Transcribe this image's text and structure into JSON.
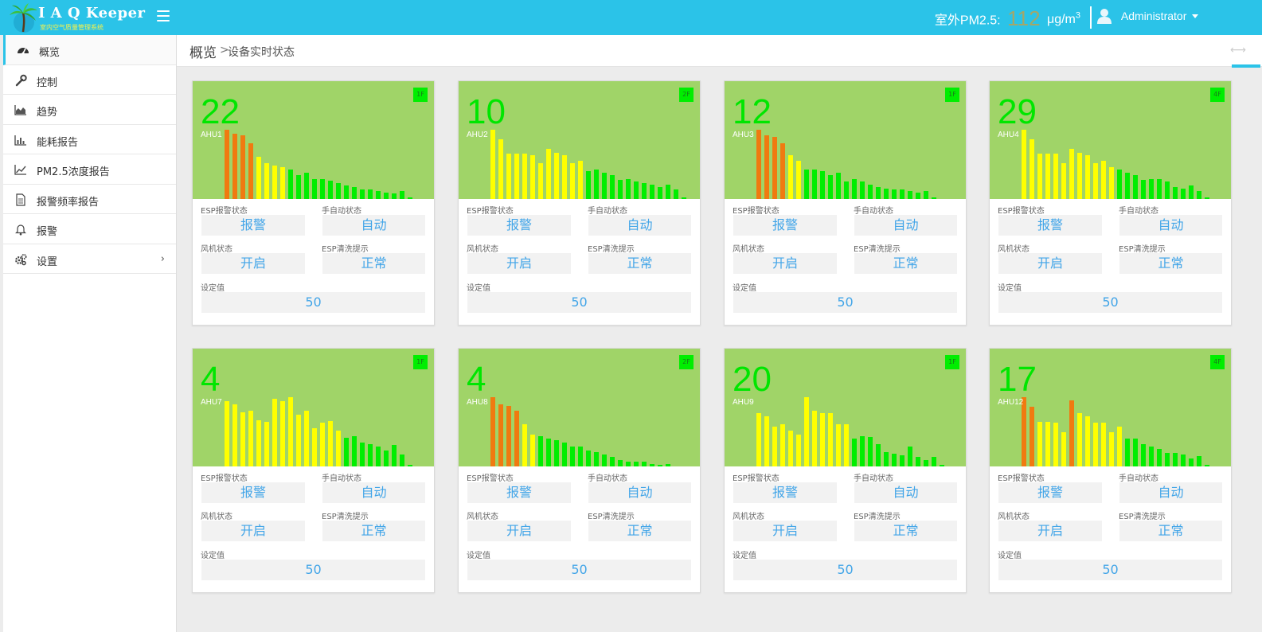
{
  "app": {
    "title": "I A Q Keeper",
    "subtitle": "室内空气质量管理系统"
  },
  "topbar": {
    "pm_label": "室外PM2.5:",
    "pm_value": "112",
    "pm_unit": "μg/m",
    "pm_unit_sup": "3",
    "user": "Administrator"
  },
  "sidebar": {
    "items": [
      {
        "label": "概览",
        "icon": "dashboard-icon",
        "active": true
      },
      {
        "label": "控制",
        "icon": "wrench-icon"
      },
      {
        "label": "趋势",
        "icon": "area-chart-icon"
      },
      {
        "label": "能耗报告",
        "icon": "bar-chart-icon"
      },
      {
        "label": "PM2.5浓度报告",
        "icon": "line-chart-icon"
      },
      {
        "label": "报警频率报告",
        "icon": "document-icon"
      },
      {
        "label": "报警",
        "icon": "bell-icon"
      },
      {
        "label": "设置",
        "icon": "gears-icon",
        "chevron": "›"
      }
    ]
  },
  "breadcrumb": {
    "root": "概览",
    "sep": ">",
    "current": "设备实时状态",
    "collapse_icon": "⟷"
  },
  "labels": {
    "esp_alarm": "ESP报警状态",
    "manual_auto": "手自动状态",
    "fan": "风机状态",
    "esp_clean": "ESP清洗提示",
    "setpoint": "设定值"
  },
  "colors": {
    "topbar": "#2bc3e8",
    "chart_bg": "#a0d468",
    "bar_orange": "#f07a10",
    "bar_yellow": "#ffff00",
    "bar_green": "#00ee00",
    "value_blue": "#42a5e8",
    "big_number": "#00e600"
  },
  "devices": [
    {
      "name": "AHU1",
      "value": "22",
      "badge": "1F",
      "esp_alarm": "报警",
      "mode": "自动",
      "fan": "开启",
      "esp_clean": "正常",
      "setpoint": "50",
      "bars": [
        87,
        82,
        80,
        70,
        53,
        45,
        42,
        40,
        37,
        30,
        33,
        25,
        25,
        23,
        20,
        17,
        15,
        12,
        12,
        10,
        8,
        7,
        10,
        2
      ]
    },
    {
      "name": "AHU2",
      "value": "10",
      "badge": "2F",
      "esp_alarm": "报警",
      "mode": "自动",
      "fan": "开启",
      "esp_clean": "正常",
      "setpoint": "50",
      "bars": [
        87,
        75,
        57,
        57,
        57,
        55,
        45,
        63,
        58,
        55,
        45,
        48,
        35,
        37,
        33,
        30,
        24,
        25,
        22,
        20,
        18,
        15,
        18,
        12,
        2
      ]
    },
    {
      "name": "AHU3",
      "value": "12",
      "badge": "1F",
      "esp_alarm": "报警",
      "mode": "自动",
      "fan": "开启",
      "esp_clean": "正常",
      "setpoint": "50",
      "bars": [
        87,
        80,
        78,
        70,
        55,
        48,
        37,
        37,
        35,
        30,
        33,
        22,
        25,
        22,
        18,
        15,
        13,
        12,
        12,
        10,
        8,
        10,
        2
      ]
    },
    {
      "name": "AHU4",
      "value": "29",
      "badge": "4F",
      "esp_alarm": "报警",
      "mode": "自动",
      "fan": "开启",
      "esp_clean": "正常",
      "setpoint": "50",
      "bars": [
        87,
        75,
        57,
        57,
        57,
        45,
        63,
        58,
        55,
        45,
        48,
        40,
        37,
        33,
        30,
        24,
        25,
        25,
        22,
        15,
        13,
        17,
        10,
        2
      ]
    },
    {
      "name": "AHU7",
      "value": "4",
      "badge": "1F",
      "esp_alarm": "报警",
      "mode": "自动",
      "fan": "开启",
      "esp_clean": "正常",
      "setpoint": "50",
      "bars": [
        82,
        78,
        68,
        70,
        58,
        56,
        85,
        82,
        87,
        65,
        70,
        48,
        55,
        57,
        45,
        36,
        38,
        30,
        28,
        25,
        20,
        27,
        15,
        2
      ]
    },
    {
      "name": "AHU8",
      "value": "4",
      "badge": "2F",
      "esp_alarm": "报警",
      "mode": "自动",
      "fan": "开启",
      "esp_clean": "正常",
      "setpoint": "50",
      "bars": [
        87,
        78,
        76,
        70,
        53,
        40,
        38,
        35,
        33,
        30,
        25,
        25,
        20,
        18,
        15,
        12,
        8,
        6,
        6,
        6,
        3,
        2,
        3
      ]
    },
    {
      "name": "AHU9",
      "value": "20",
      "badge": "1F",
      "esp_alarm": "报警",
      "mode": "自动",
      "fan": "开启",
      "esp_clean": "正常",
      "setpoint": "50",
      "bars": [
        67,
        63,
        50,
        53,
        45,
        40,
        87,
        70,
        67,
        67,
        53,
        53,
        35,
        38,
        37,
        28,
        18,
        16,
        14,
        25,
        12,
        8,
        12,
        2
      ]
    },
    {
      "name": "AHU12",
      "value": "17",
      "badge": "4F",
      "esp_alarm": "报警",
      "mode": "自动",
      "fan": "开启",
      "esp_clean": "正常",
      "setpoint": "50",
      "bars": [
        87,
        75,
        56,
        56,
        55,
        43,
        83,
        67,
        63,
        55,
        55,
        43,
        50,
        35,
        35,
        28,
        25,
        22,
        17,
        17,
        15,
        10,
        13,
        2
      ]
    }
  ]
}
